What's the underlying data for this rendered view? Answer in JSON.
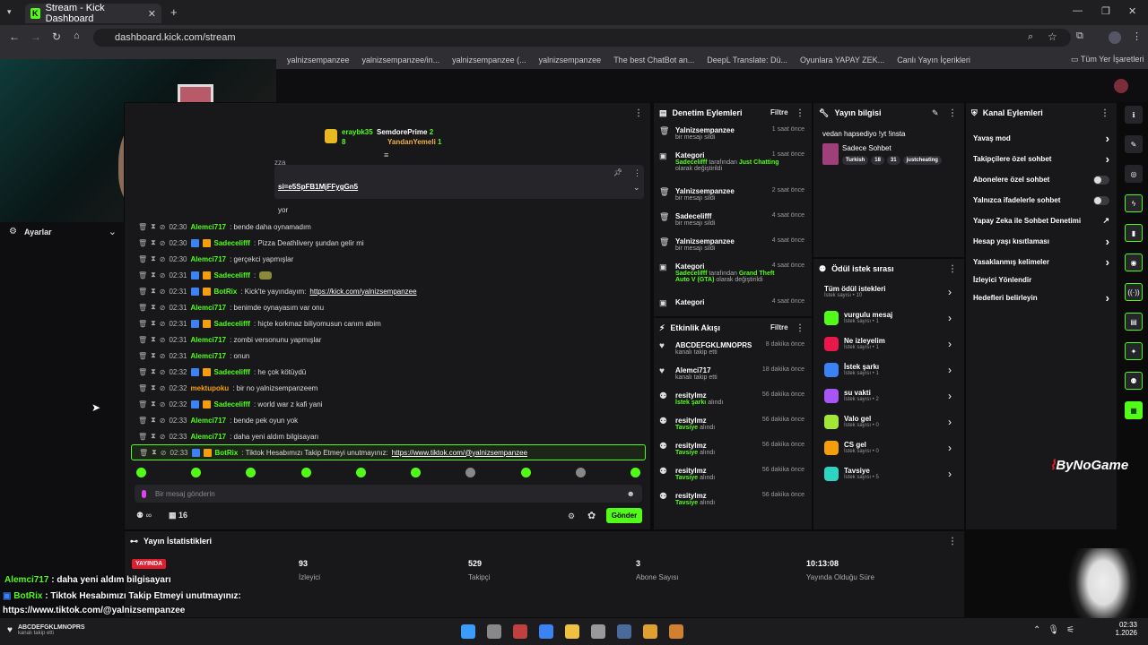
{
  "browser": {
    "tab_title": "Stream - Kick Dashboard",
    "url": "dashboard.kick.com/stream",
    "bookmarks": [
      "yalnizsempanzee",
      "yalnizsempanzee/in...",
      "yalnizsempanzee (...",
      "yalnizsempanzee",
      "The best ChatBot an...",
      "DeepL Translate: Dü...",
      "Oyunlara YAPAY ZEK...",
      "Canlı Yayın İçerikleri"
    ],
    "all_bookmarks": "Tüm Yer İşaretleri"
  },
  "left": {
    "settings": "Ayarlar"
  },
  "chat": {
    "top_users": [
      {
        "name": "eraybk35",
        "count": "8"
      },
      {
        "name": "SemdorePrime",
        "count": "2"
      },
      {
        "name": "YandanYemeli",
        "count": "1"
      }
    ],
    "pinned_link": "si=e5SpFB1MjFFygGn5",
    "partial_top": "yor",
    "partial_za": "zza",
    "messages": [
      {
        "time": "02:30",
        "user": "Alemci717",
        "text": ": bende daha oynamadım",
        "badges": false
      },
      {
        "time": "02:30",
        "user": "Sadecelifff",
        "text": ": Pizza Deathlivery şundan gelir mi",
        "badges": true
      },
      {
        "time": "02:30",
        "user": "Alemci717",
        "text": ": gerçekci yapmışlar",
        "badges": false
      },
      {
        "time": "02:31",
        "user": "Sadecelifff",
        "text": ":",
        "badges": true
      },
      {
        "time": "02:31",
        "user": "BotRix",
        "text": ": Kick'te yayındayım: ",
        "link": "https://kick.com/yalnizsempanzee",
        "badges": true
      },
      {
        "time": "02:31",
        "user": "Alemci717",
        "text": ": benimde oynayasım var onu",
        "badges": false
      },
      {
        "time": "02:31",
        "user": "Sadecelifff",
        "text": ": hiçte korkmaz biliyomusun canım abim",
        "badges": true
      },
      {
        "time": "02:31",
        "user": "Alemci717",
        "text": ": zombi versonunu yapmışlar",
        "badges": false
      },
      {
        "time": "02:31",
        "user": "Alemci717",
        "text": ": onun",
        "badges": false
      },
      {
        "time": "02:32",
        "user": "Sadecelifff",
        "text": ": he çok kötüydü",
        "badges": true
      },
      {
        "time": "02:32",
        "user": "mektupoku",
        "text": ": bir no yalnizsempanzeem",
        "badges": false
      },
      {
        "time": "02:32",
        "user": "Sadecelifff",
        "text": ": world war z kafi yani",
        "badges": true
      },
      {
        "time": "02:33",
        "user": "Alemci717",
        "text": ": bende pek oyun yok",
        "badges": false
      },
      {
        "time": "02:33",
        "user": "Alemci717",
        "text": ": daha yeni aldım bilgisayarı",
        "badges": false
      },
      {
        "time": "02:33",
        "user": "BotRix",
        "text": ": Tiktok Hesabımızı Takip Etmeyi unutmayınız: ",
        "link": "https://www.tiktok.com/@yalnizsempanzee",
        "badges": true
      }
    ],
    "input_placeholder": "Bir mesaj gönderin",
    "viewer_count": "16",
    "send_label": "Gönder"
  },
  "moderation": {
    "title": "Denetim Eylemleri",
    "filter": "Filtre",
    "items": [
      {
        "title": "Yalnizsempanzee",
        "sub": "bir mesajı sildi",
        "time": "1 saat önce"
      },
      {
        "title": "Kategori",
        "sub_user": "Sadecelifff",
        "sub_mid": " tarafından ",
        "sub_cat": "Just Chatting",
        "sub_end": " olarak değiştirildi",
        "time": "1 saat önce"
      },
      {
        "title": "Yalnizsempanzee",
        "sub": "bir mesajı sildi",
        "time": "2 saat önce"
      },
      {
        "title": "Sadecelifff",
        "sub": "bir mesajı sildi",
        "time": "4 saat önce"
      },
      {
        "title": "Yalnizsempanzee",
        "sub": "bir mesajı sildi",
        "time": "4 saat önce"
      },
      {
        "title": "Kategori",
        "sub_user": "Sadecelifff",
        "sub_mid": " tarafından ",
        "sub_cat": "Grand Theft Auto V (GTA)",
        "sub_end": " olarak değiştirildi",
        "time": "4 saat önce"
      },
      {
        "title": "Kategori",
        "sub": "",
        "time": "4 saat önce"
      }
    ]
  },
  "activity": {
    "title": "Etkinlik Akışı",
    "filter": "Filtre",
    "items": [
      {
        "title": "ABCDEFGKLMNOPRS",
        "sub": "kanalı takip etti",
        "time": "8 dakika önce",
        "kind": "follow"
      },
      {
        "title": "Alemci717",
        "sub": "kanalı takip etti",
        "time": "18 dakika önce",
        "kind": "follow"
      },
      {
        "title": "resitylmz",
        "sub": "İstek şarkı",
        "sub2": " alındı",
        "time": "56 dakika önce",
        "kind": "reward"
      },
      {
        "title": "resitylmz",
        "sub": "Tavsiye",
        "sub2": " alındı",
        "time": "56 dakika önce",
        "kind": "reward"
      },
      {
        "title": "resitylmz",
        "sub": "Tavsiye",
        "sub2": " alındı",
        "time": "56 dakika önce",
        "kind": "reward"
      },
      {
        "title": "resitylmz",
        "sub": "Tavsiye",
        "sub2": " alındı",
        "time": "56 dakika önce",
        "kind": "reward"
      },
      {
        "title": "resitylmz",
        "sub": "Tavsiye",
        "sub2": " alındı",
        "time": "56 dakika önce",
        "kind": "reward"
      }
    ]
  },
  "stream_info": {
    "title": "Yayın bilgisi",
    "stream_title": "vedan hapsediyo !yt !insta",
    "category": "Sadece Sohbet",
    "tags": [
      "Turkish",
      "18",
      "31",
      "justcheating"
    ]
  },
  "rewards": {
    "title": "Ödül istek sırası",
    "items": [
      {
        "title": "Tüm ödül istekleri",
        "sub": "İstek sayısı • 10",
        "color": ""
      },
      {
        "title": "vurgulu mesaj",
        "sub": "İstek sayısı • 1",
        "color": "#53fc18"
      },
      {
        "title": "Ne izleyelim",
        "sub": "İstek sayısı • 1",
        "color": "#e8194a"
      },
      {
        "title": "İstek şarkı",
        "sub": "İstek sayısı • 1",
        "color": "#3b82f6"
      },
      {
        "title": "su vakti",
        "sub": "İstek sayısı • 2",
        "color": "#a855f7"
      },
      {
        "title": "Valo gel",
        "sub": "İstek sayısı • 0",
        "color": "#a3e635"
      },
      {
        "title": "CS gel",
        "sub": "İstek sayısı • 0",
        "color": "#f59e0b"
      },
      {
        "title": "Tavsiye",
        "sub": "İstek sayısı • 5",
        "color": "#2dd4bf"
      }
    ]
  },
  "channel_actions": {
    "title": "Kanal Eylemleri",
    "items": [
      {
        "label": "Yavaş mod",
        "type": "chevron"
      },
      {
        "label": "Takipçilere özel sohbet",
        "type": "chevron"
      },
      {
        "label": "Abonelere özel sohbet",
        "type": "toggle"
      },
      {
        "label": "Yalnızca ifadelerle sohbet",
        "type": "toggle"
      },
      {
        "label": "Yapay Zeka ile Sohbet Denetimi",
        "type": "link"
      },
      {
        "label": "Hesap yaşı kısıtlaması",
        "type": "chevron"
      },
      {
        "label": "Yasaklanmış kelimeler",
        "type": "chevron"
      },
      {
        "label": "İzleyici Yönlendir",
        "type": "none"
      },
      {
        "label": "Hedefleri belirleyin",
        "type": "chevron"
      }
    ]
  },
  "stats": {
    "title": "Yayın İstatistikleri",
    "live_badge": "YAYINDA",
    "items": [
      {
        "value": "93",
        "label": "İzleyici"
      },
      {
        "value": "529",
        "label": "Takipçi"
      },
      {
        "value": "3",
        "label": "Abone Sayısı"
      },
      {
        "value": "10:13:08",
        "label": "Yayında Olduğu Süre"
      }
    ]
  },
  "overlay": {
    "line1_user": "Alemci717",
    "line1_text": " : daha yeni aldım bilgisayarı",
    "line2_user": "BotRix",
    "line2_text": " : Tiktok Hesabımızı Takip Etmeyi unutmayınız:",
    "line3": "https://www.tiktok.com/@yalnizsempanzee",
    "brand": "ByNoGame",
    "follow_user": "ABCDEFGKLMNOPRS",
    "follow_sub": "kanalı takip etti"
  },
  "taskbar": {
    "time": "02:33",
    "date": "1.2026"
  }
}
